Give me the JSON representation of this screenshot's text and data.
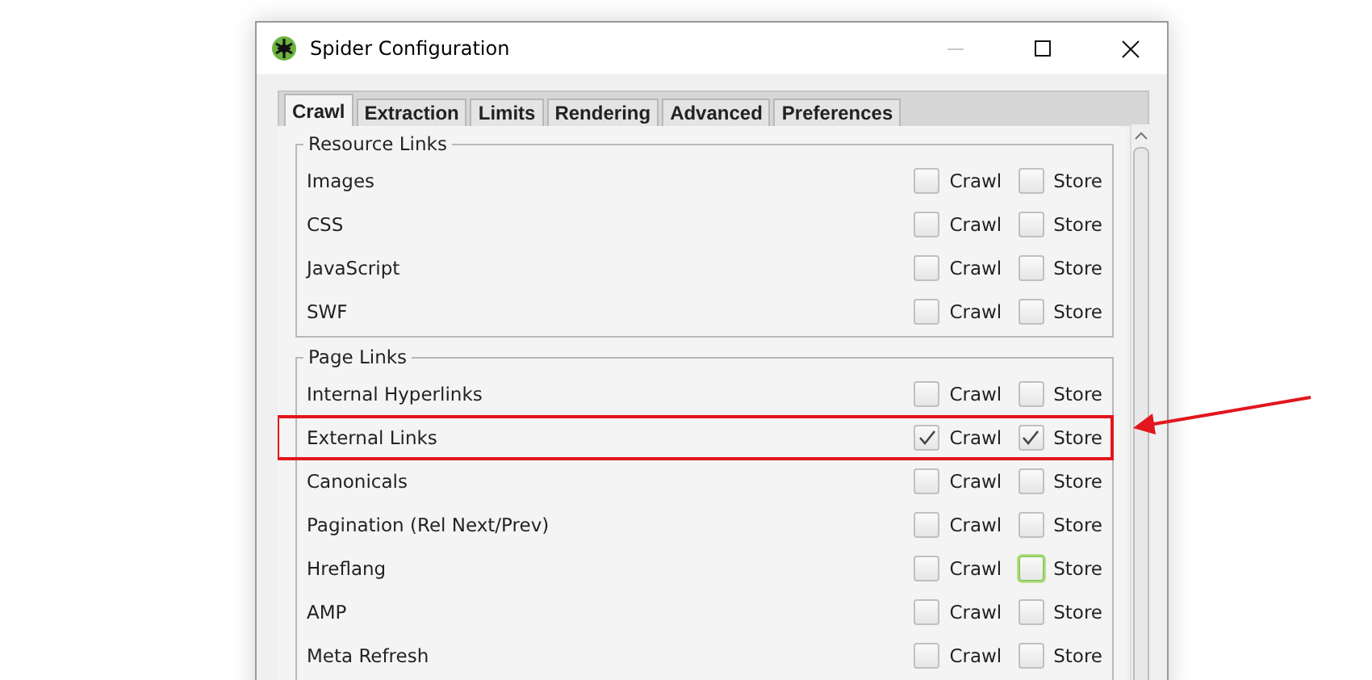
{
  "window": {
    "title": "Spider Configuration"
  },
  "tabs": [
    {
      "label": "Crawl",
      "selected": true
    },
    {
      "label": "Extraction",
      "selected": false
    },
    {
      "label": "Limits",
      "selected": false
    },
    {
      "label": "Rendering",
      "selected": false
    },
    {
      "label": "Advanced",
      "selected": false
    },
    {
      "label": "Preferences",
      "selected": false
    }
  ],
  "groups": [
    {
      "title": "Resource Links",
      "rows": [
        {
          "label": "Images",
          "highlighted": false,
          "options": [
            {
              "label": "Crawl",
              "checked": false,
              "focused": false
            },
            {
              "label": "Store",
              "checked": false,
              "focused": false
            }
          ]
        },
        {
          "label": "CSS",
          "highlighted": false,
          "options": [
            {
              "label": "Crawl",
              "checked": false,
              "focused": false
            },
            {
              "label": "Store",
              "checked": false,
              "focused": false
            }
          ]
        },
        {
          "label": "JavaScript",
          "highlighted": false,
          "options": [
            {
              "label": "Crawl",
              "checked": false,
              "focused": false
            },
            {
              "label": "Store",
              "checked": false,
              "focused": false
            }
          ]
        },
        {
          "label": "SWF",
          "highlighted": false,
          "options": [
            {
              "label": "Crawl",
              "checked": false,
              "focused": false
            },
            {
              "label": "Store",
              "checked": false,
              "focused": false
            }
          ]
        }
      ]
    },
    {
      "title": "Page Links",
      "rows": [
        {
          "label": "Internal Hyperlinks",
          "highlighted": false,
          "options": [
            {
              "label": "Crawl",
              "checked": false,
              "focused": false
            },
            {
              "label": "Store",
              "checked": false,
              "focused": false
            }
          ]
        },
        {
          "label": "External Links",
          "highlighted": true,
          "options": [
            {
              "label": "Crawl",
              "checked": true,
              "focused": false
            },
            {
              "label": "Store",
              "checked": true,
              "focused": false
            }
          ]
        },
        {
          "label": "Canonicals",
          "highlighted": false,
          "options": [
            {
              "label": "Crawl",
              "checked": false,
              "focused": false
            },
            {
              "label": "Store",
              "checked": false,
              "focused": false
            }
          ]
        },
        {
          "label": "Pagination (Rel Next/Prev)",
          "highlighted": false,
          "options": [
            {
              "label": "Crawl",
              "checked": false,
              "focused": false
            },
            {
              "label": "Store",
              "checked": false,
              "focused": false
            }
          ]
        },
        {
          "label": "Hreflang",
          "highlighted": false,
          "options": [
            {
              "label": "Crawl",
              "checked": false,
              "focused": false
            },
            {
              "label": "Store",
              "checked": false,
              "focused": true
            }
          ]
        },
        {
          "label": "AMP",
          "highlighted": false,
          "options": [
            {
              "label": "Crawl",
              "checked": false,
              "focused": false
            },
            {
              "label": "Store",
              "checked": false,
              "focused": false
            }
          ]
        },
        {
          "label": "Meta Refresh",
          "highlighted": false,
          "options": [
            {
              "label": "Crawl",
              "checked": false,
              "focused": false
            },
            {
              "label": "Store",
              "checked": false,
              "focused": false
            }
          ]
        }
      ]
    }
  ]
}
